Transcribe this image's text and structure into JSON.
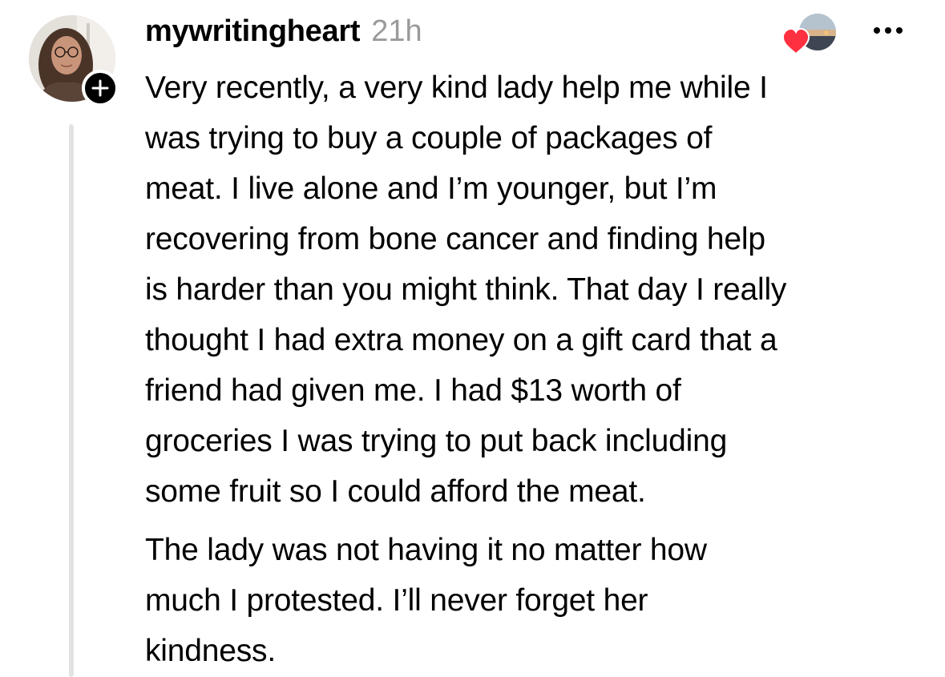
{
  "post": {
    "username": "mywritingheart",
    "timestamp": "21h",
    "paragraphs": [
      "Very recently, a very kind lady help me while I\nwas trying to buy a couple of packages of\nmeat. I live alone and I’m younger, but I’m\nrecovering from bone cancer and finding help\nis harder than you might think. That day I really\nthought I had extra money on a gift card that a\nfriend had given me. I had $13 worth of\ngroceries I was trying to put back including\nsome fruit so I could afford the meat.",
      "The lady was not having it no matter how\nmuch I protested. I’ll never forget her\nkindness."
    ]
  },
  "icons": {
    "follow": "plus-icon",
    "liked_by": "heart-icon",
    "more": "more-horizontal-icon"
  },
  "colors": {
    "heart": "#ff3040",
    "timestamp": "#9a9a9a",
    "thread_line": "#e3e3e3",
    "badge": "#000000"
  }
}
